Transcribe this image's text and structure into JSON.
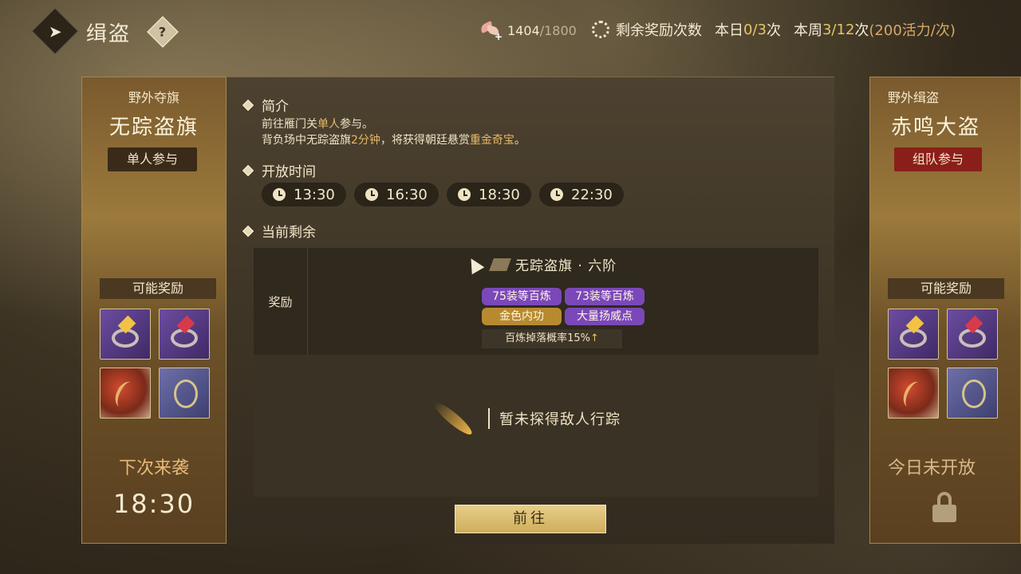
{
  "header": {
    "title": "缉盗",
    "back_icon": "back-arrow-icon",
    "help_label": "?"
  },
  "energy": {
    "icon": "wings-plus-icon",
    "current": "1404",
    "max": "/1800"
  },
  "reward_info": {
    "label": "剩余奖励次数",
    "daily_label": "本日",
    "daily_value": "0/3",
    "daily_unit": "次",
    "weekly_label": "本周",
    "weekly_value": "3/12",
    "weekly_unit": "次",
    "cost_note": "(200活力/次)"
  },
  "left_card": {
    "subtitle": "野外夺旗",
    "title": "无踪盗旗",
    "mode": "单人参与",
    "rewards_label": "可能奖励",
    "next_label": "下次来袭",
    "next_time": "18:30"
  },
  "right_card": {
    "subtitle": "野外缉盗",
    "title": "赤鸣大盗",
    "mode": "组队参与",
    "rewards_label": "可能奖励",
    "status": "今日未开放"
  },
  "main": {
    "intro_label": "简介",
    "intro_line1_a": "前往雁门关",
    "intro_line1_hl": "单人",
    "intro_line1_b": "参与。",
    "intro_line2_a": "背负场中无踪盗旗",
    "intro_line2_hl1": "2分钟",
    "intro_line2_b": "，将获得朝廷悬赏",
    "intro_line2_hl2": "重金奇宝",
    "intro_line2_c": "。",
    "open_time_label": "开放时间",
    "times": [
      "13:30",
      "16:30",
      "18:30",
      "22:30"
    ],
    "remaining_label": "当前剩余",
    "flag_title": "无踪盗旗 · 六阶",
    "reward_label": "奖励",
    "tags": [
      "75装等百炼",
      "73装等百炼",
      "金色内功",
      "大量扬威点"
    ],
    "drop_rate": "百炼掉落概率15%",
    "empty_text": "暂未探得敌人行踪",
    "go_button": "前往"
  }
}
